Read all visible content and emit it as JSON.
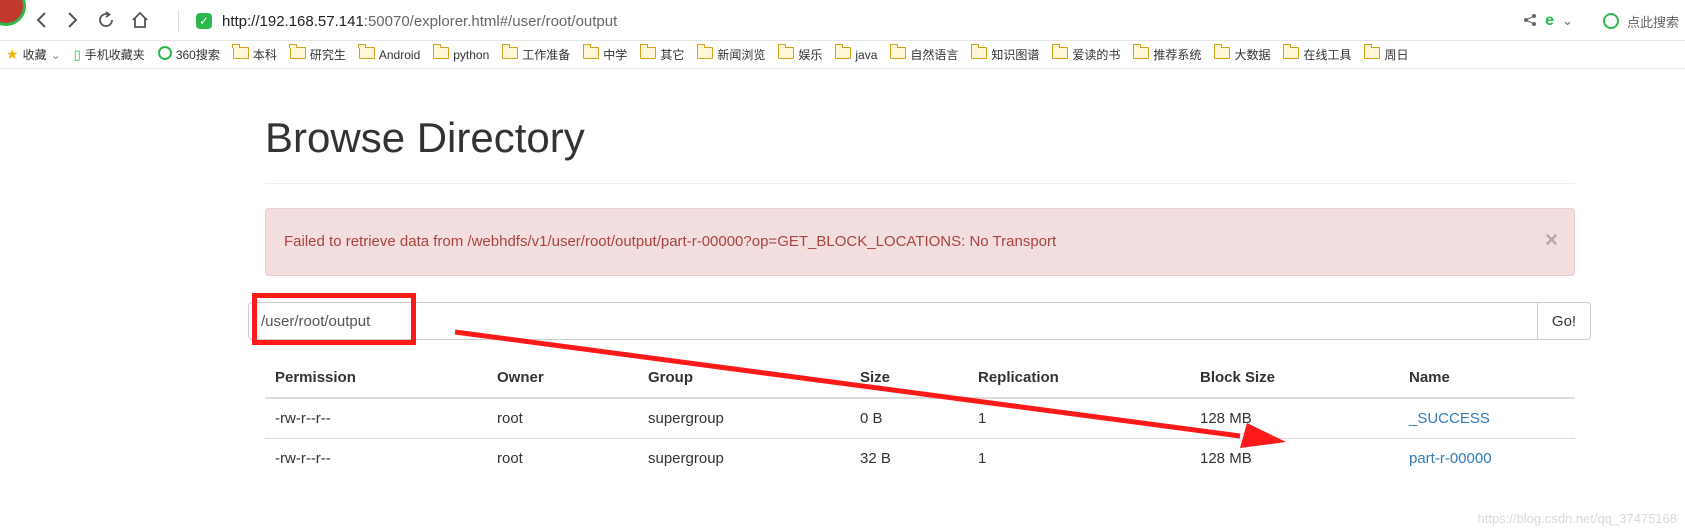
{
  "browser": {
    "url_host": "http://192.168.57.141",
    "url_rest": ":50070/explorer.html#/user/root/output",
    "search_placeholder": "点此搜索",
    "bookmarks": [
      {
        "label": "收藏",
        "icon": "star-icon"
      },
      {
        "label": "手机收藏夹",
        "icon": "phone-icon"
      },
      {
        "label": "360搜索",
        "icon": "360-icon"
      },
      {
        "label": "本科",
        "icon": "folder-icon"
      },
      {
        "label": "研究生",
        "icon": "folder-icon"
      },
      {
        "label": "Android",
        "icon": "folder-icon"
      },
      {
        "label": "python",
        "icon": "folder-icon"
      },
      {
        "label": "工作准备",
        "icon": "folder-icon"
      },
      {
        "label": "中学",
        "icon": "folder-icon"
      },
      {
        "label": "其它",
        "icon": "folder-icon"
      },
      {
        "label": "新闻浏览",
        "icon": "folder-icon"
      },
      {
        "label": "娱乐",
        "icon": "folder-icon"
      },
      {
        "label": "java",
        "icon": "folder-icon"
      },
      {
        "label": "自然语言",
        "icon": "folder-icon"
      },
      {
        "label": "知识图谱",
        "icon": "folder-icon"
      },
      {
        "label": "爱读的书",
        "icon": "folder-icon"
      },
      {
        "label": "推荐系统",
        "icon": "folder-icon"
      },
      {
        "label": "大数据",
        "icon": "folder-icon"
      },
      {
        "label": "在线工具",
        "icon": "folder-icon"
      },
      {
        "label": "周日",
        "icon": "folder-icon"
      }
    ]
  },
  "page": {
    "title": "Browse Directory",
    "alert": "Failed to retrieve data from /webhdfs/v1/user/root/output/part-r-00000?op=GET_BLOCK_LOCATIONS: No Transport",
    "alert_close": "×",
    "path_value": "/user/root/output",
    "go_label": "Go!"
  },
  "table": {
    "headers": [
      "Permission",
      "Owner",
      "Group",
      "Size",
      "Replication",
      "Block Size",
      "Name"
    ],
    "rows": [
      [
        "-rw-r--r--",
        "root",
        "supergroup",
        "0 B",
        "1",
        "128 MB",
        "_SUCCESS"
      ],
      [
        "-rw-r--r--",
        "root",
        "supergroup",
        "32 B",
        "1",
        "128 MB",
        "part-r-00000"
      ]
    ]
  },
  "watermark": "https://blog.csdn.net/qq_37475168",
  "colors": {
    "alert_bg": "#f2dede",
    "alert_text": "#a94442",
    "link": "#337ab7",
    "annotation_red": "#ff1a1a"
  }
}
